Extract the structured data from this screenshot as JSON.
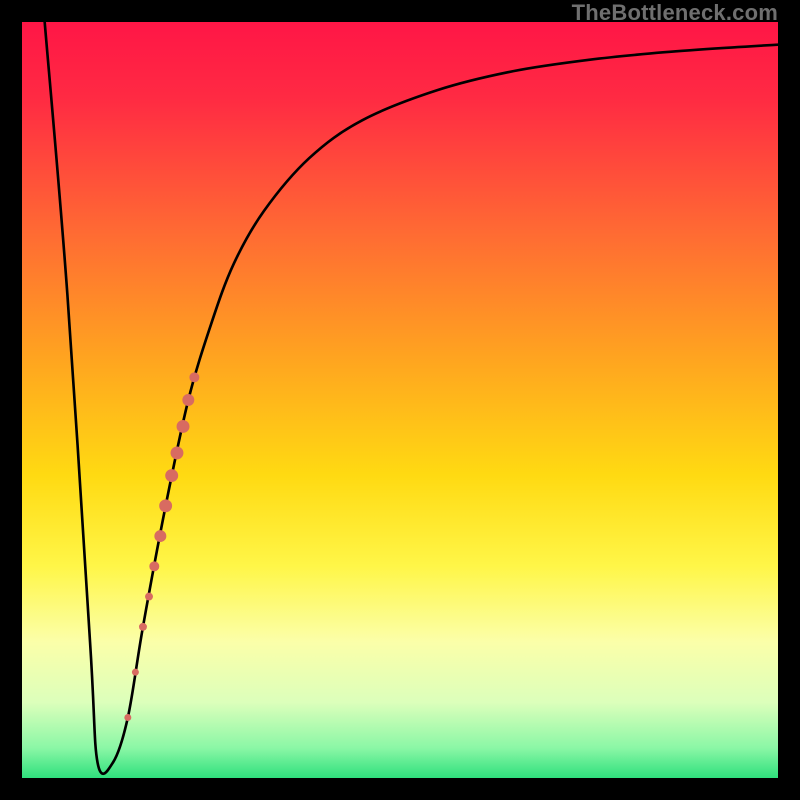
{
  "watermark": {
    "text": "TheBottleneck.com"
  },
  "colors": {
    "frame_bg": "#000000",
    "curve": "#000000",
    "marker": "#d86b61",
    "grad_stops": [
      {
        "offset": 0.0,
        "color": "#ff1646"
      },
      {
        "offset": 0.1,
        "color": "#ff2a43"
      },
      {
        "offset": 0.28,
        "color": "#ff6b33"
      },
      {
        "offset": 0.45,
        "color": "#ffa61f"
      },
      {
        "offset": 0.6,
        "color": "#ffda12"
      },
      {
        "offset": 0.72,
        "color": "#fff648"
      },
      {
        "offset": 0.82,
        "color": "#fbffa9"
      },
      {
        "offset": 0.9,
        "color": "#dcffbb"
      },
      {
        "offset": 0.96,
        "color": "#8bf7a6"
      },
      {
        "offset": 1.0,
        "color": "#2fe07d"
      }
    ]
  },
  "chart_data": {
    "type": "line",
    "title": "",
    "xlabel": "",
    "ylabel": "",
    "xlim": [
      0,
      100
    ],
    "ylim": [
      0,
      100
    ],
    "series": [
      {
        "name": "bottleneck-curve",
        "x": [
          3,
          6,
          9,
          10,
          12,
          14,
          16,
          19,
          22,
          25,
          28,
          32,
          38,
          45,
          55,
          65,
          75,
          85,
          95,
          100
        ],
        "y": [
          100,
          64,
          18,
          2,
          2,
          8,
          20,
          36,
          50,
          60,
          68,
          75,
          82,
          87,
          91,
          93.5,
          95,
          96,
          96.7,
          97
        ]
      }
    ],
    "markers": {
      "name": "highlight-segment",
      "points": [
        {
          "x": 14.0,
          "y": 8.0,
          "r": 3.5
        },
        {
          "x": 15.0,
          "y": 14.0,
          "r": 3.5
        },
        {
          "x": 16.0,
          "y": 20.0,
          "r": 4.0
        },
        {
          "x": 16.8,
          "y": 24.0,
          "r": 4.0
        },
        {
          "x": 17.5,
          "y": 28.0,
          "r": 5.0
        },
        {
          "x": 18.3,
          "y": 32.0,
          "r": 6.0
        },
        {
          "x": 19.0,
          "y": 36.0,
          "r": 6.5
        },
        {
          "x": 19.8,
          "y": 40.0,
          "r": 6.5
        },
        {
          "x": 20.5,
          "y": 43.0,
          "r": 6.5
        },
        {
          "x": 21.3,
          "y": 46.5,
          "r": 6.5
        },
        {
          "x": 22.0,
          "y": 50.0,
          "r": 6.0
        },
        {
          "x": 22.8,
          "y": 53.0,
          "r": 5.0
        }
      ]
    }
  }
}
